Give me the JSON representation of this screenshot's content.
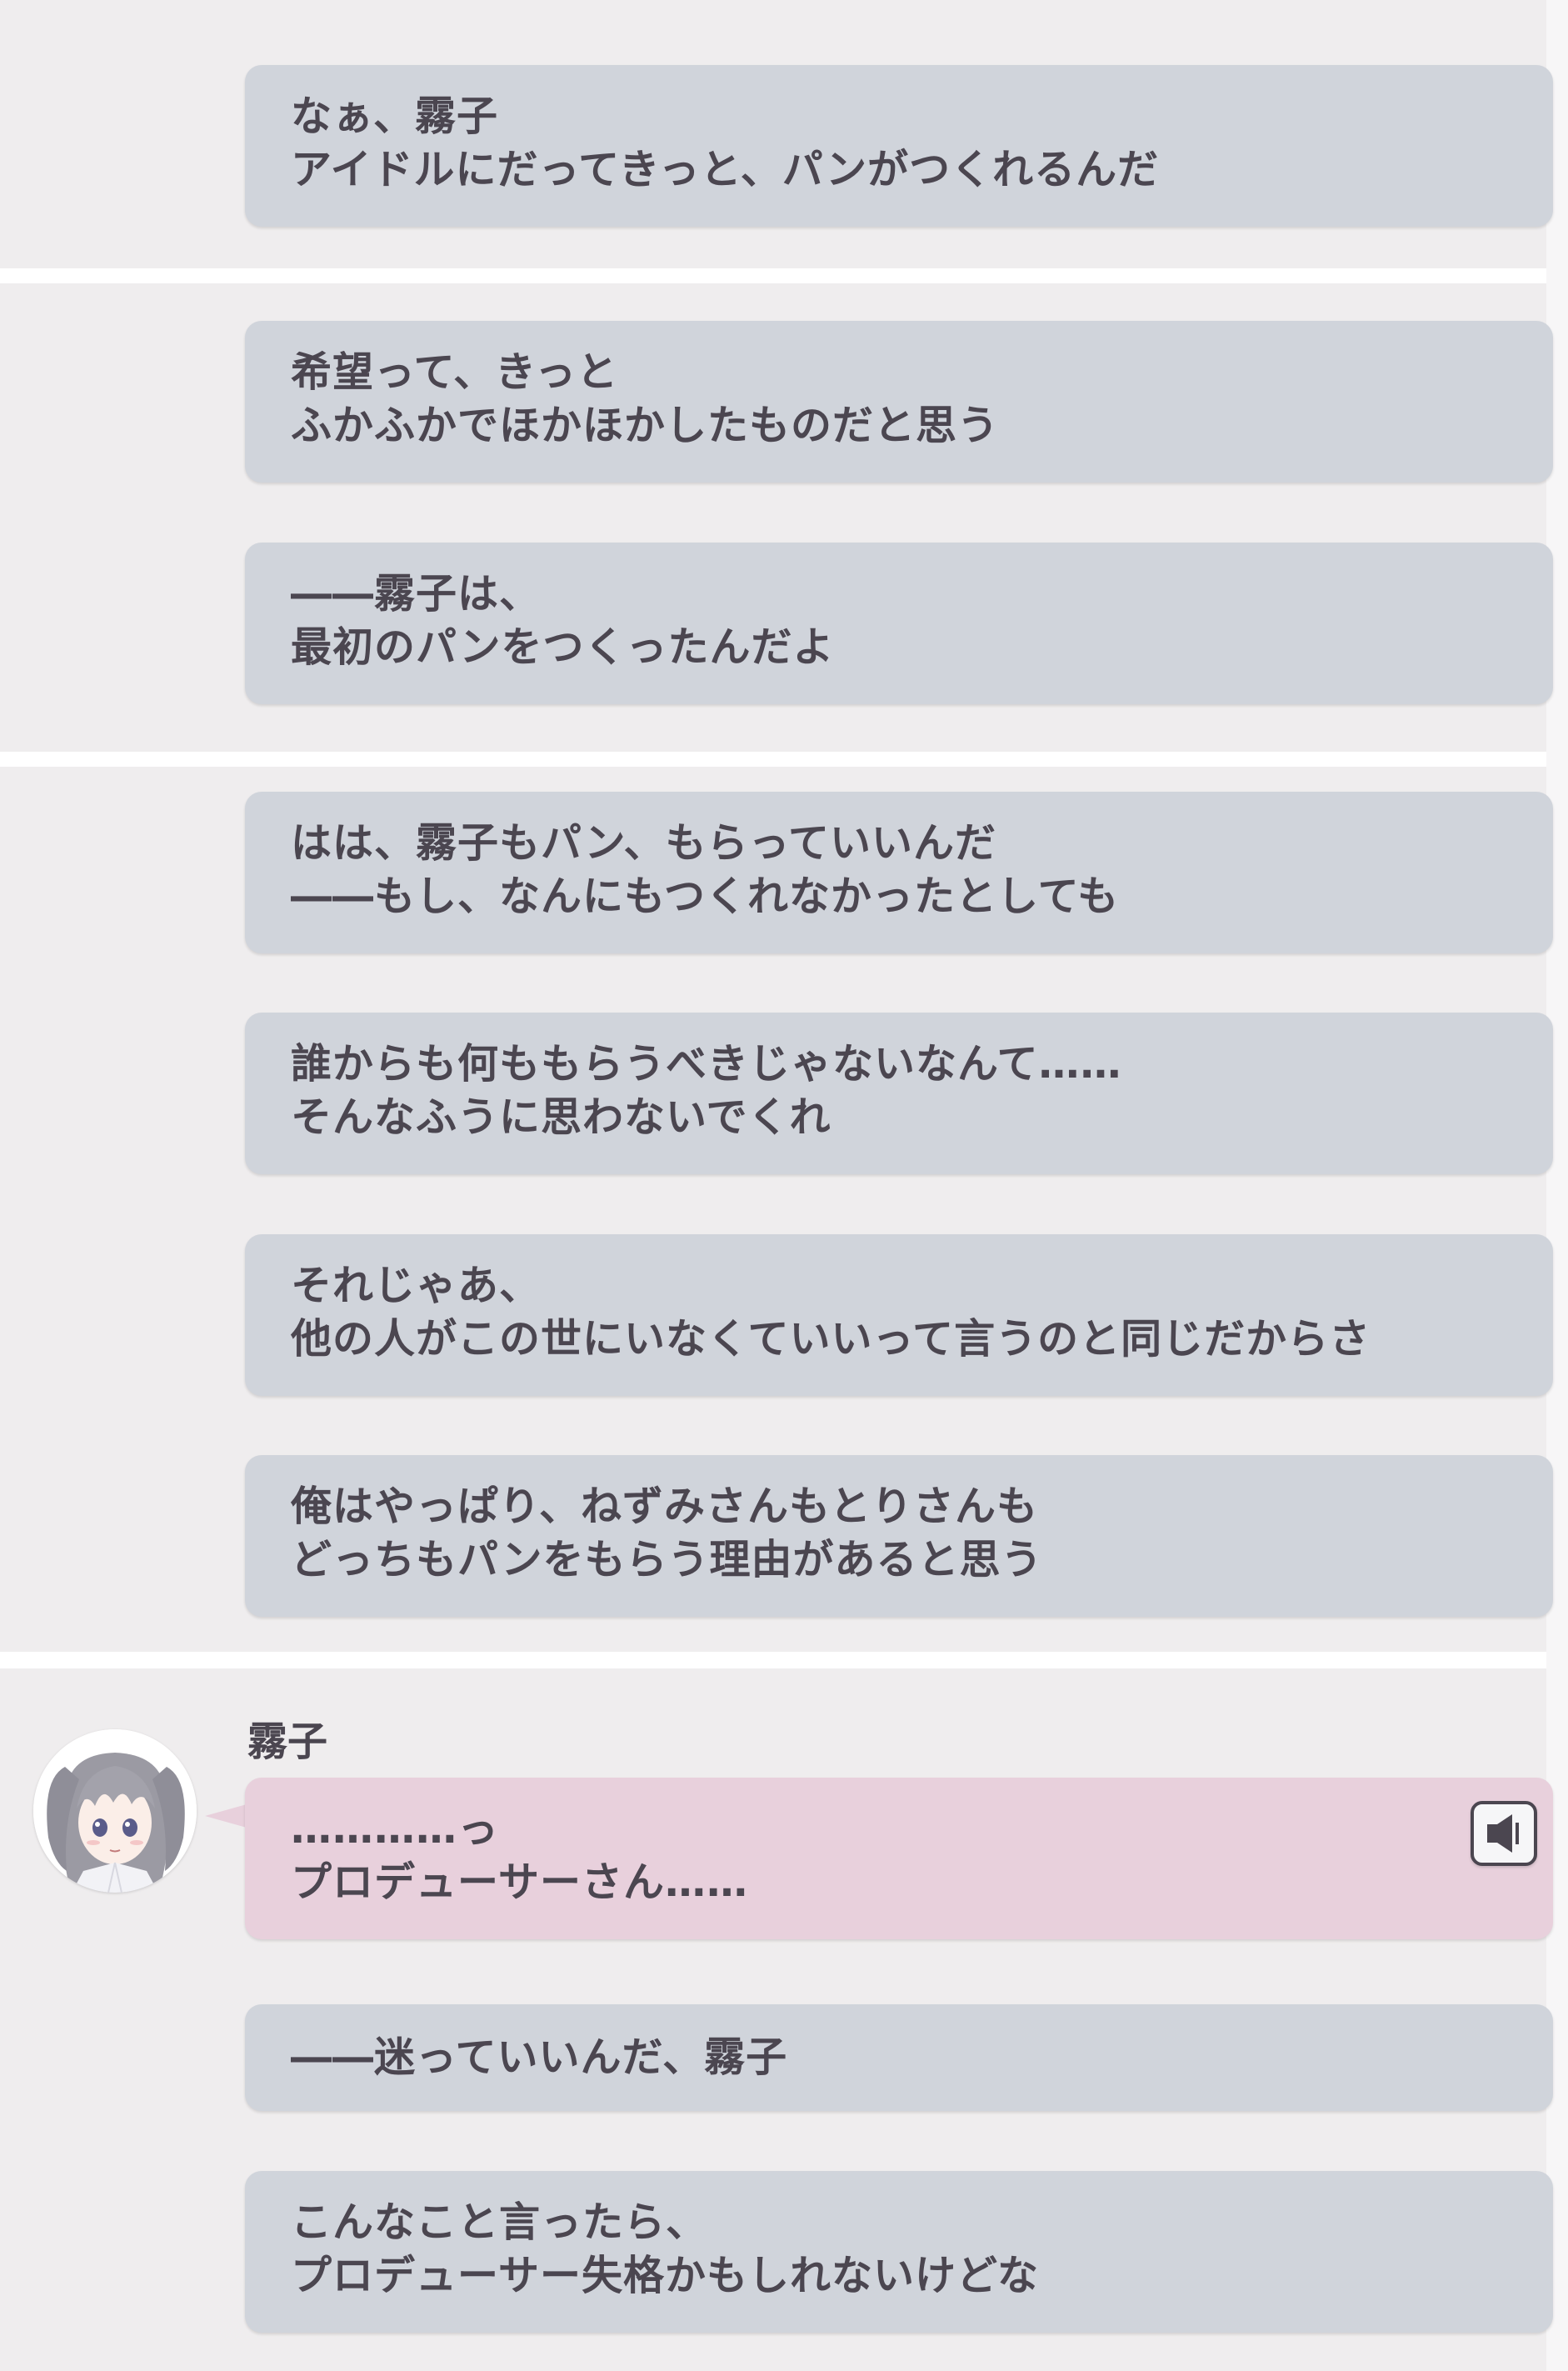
{
  "app": {
    "colors": {
      "panel_bg": "#efedee",
      "bubble_gray": "#d0d4db",
      "bubble_pink": "#e8d0dc",
      "text": "#4b4650"
    }
  },
  "panels": [
    {
      "bubbles": [
        {
          "lines": [
            "なぁ、霧子",
            "アイドルにだってきっと、パンがつくれるんだ"
          ]
        }
      ]
    },
    {
      "bubbles": [
        {
          "lines": [
            "希望って、きっと",
            "ふかふかでほかほかしたものだと思う"
          ]
        },
        {
          "lines": [
            "――霧子は、",
            "最初のパンをつくったんだよ"
          ]
        }
      ]
    },
    {
      "bubbles": [
        {
          "lines": [
            "はは、霧子もパン、もらっていいんだ",
            "――もし、なんにもつくれなかったとしても"
          ]
        },
        {
          "lines": [
            "誰からも何ももらうべきじゃないなんて……",
            "そんなふうに思わないでくれ"
          ]
        },
        {
          "lines": [
            "それじゃあ、",
            "他の人がこの世にいなくていいって言うのと同じだからさ"
          ]
        },
        {
          "lines": [
            "俺はやっぱり、ねずみさんもとりさんも",
            "どっちもパンをもらう理由があると思う"
          ]
        }
      ]
    },
    {
      "speaker": {
        "name": "霧子",
        "avatar_icon": "character-portrait-icon",
        "voice_icon": "speaker-voice-icon",
        "lines": [
          "…………っ",
          "プロデューサーさん……"
        ]
      },
      "bubbles": [
        {
          "lines": [
            "――迷っていいんだ、霧子"
          ]
        },
        {
          "lines": [
            "こんなこと言ったら、",
            "プロデューサー失格かもしれないけどな"
          ]
        }
      ]
    }
  ]
}
